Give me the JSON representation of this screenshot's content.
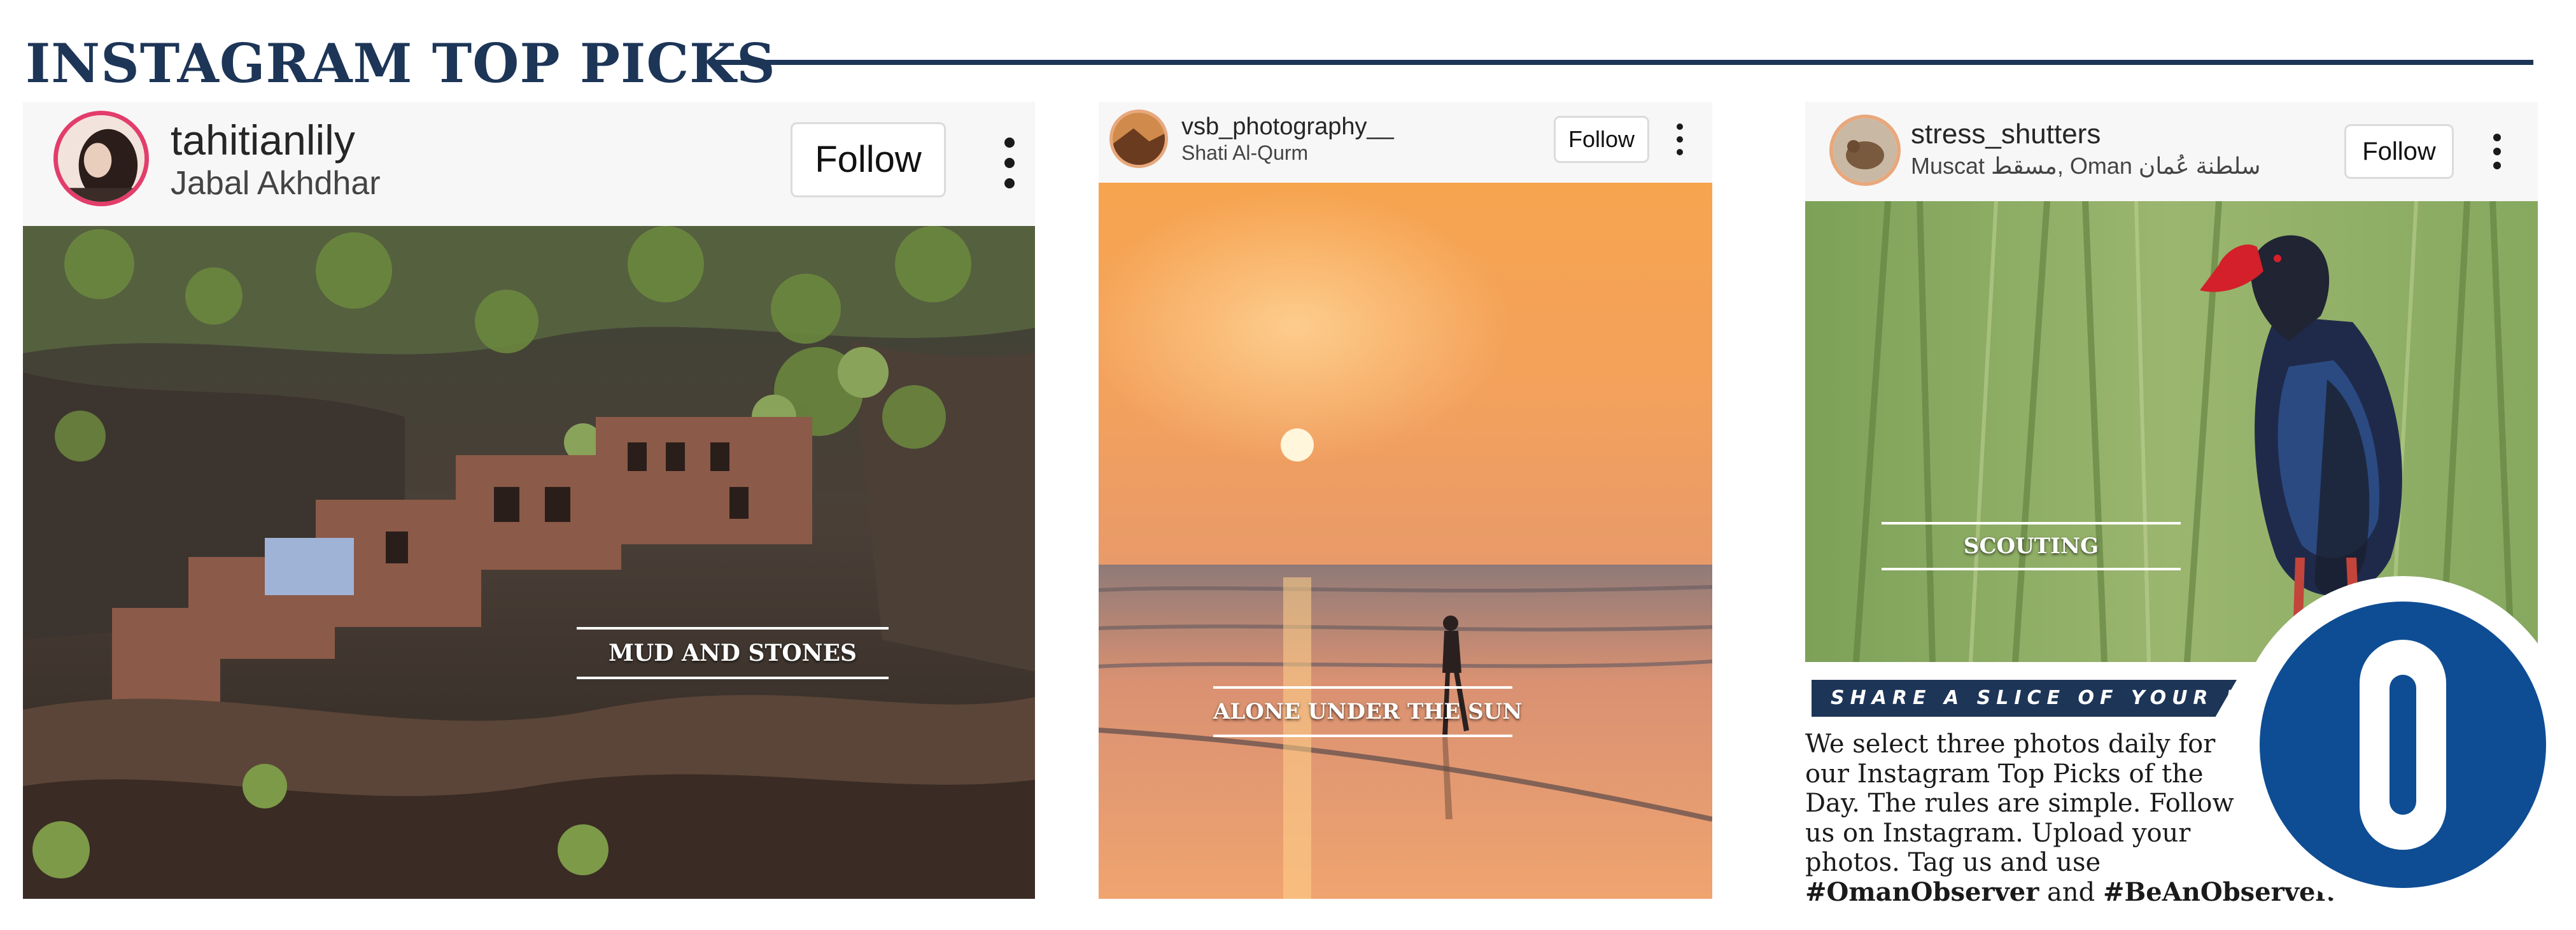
{
  "section": {
    "title": "INSTAGRAM TOP PICKS"
  },
  "colors": {
    "navy": "#1d3557",
    "logo_blue": "#0e4d94"
  },
  "posts": [
    {
      "username": "tahitianlily",
      "location": "Jabal Akhdhar",
      "follow_label": "Follow",
      "caption": "MUD AND STONES",
      "photo_subject": "ruined mud-brick village on a mountain cliffside"
    },
    {
      "username": "vsb_photography__",
      "location": "Shati Al-Qurm",
      "follow_label": "Follow",
      "caption": "ALONE UNDER THE SUN",
      "photo_subject": "silhouette of a child walking along the beach at sunset"
    },
    {
      "username": "stress_shutters",
      "location": "Muscat مسقط, Oman سلطنة عُمان",
      "follow_label": "Follow",
      "caption": "SCOUTING",
      "photo_subject": "purple swamphen standing in tall green reeds"
    }
  ],
  "share": {
    "banner": "SHARE A SLICE OF YOUR LIFE",
    "lines": [
      "We select three photos daily for",
      "our Instagram Top Picks of the",
      "Day. The rules are simple. Follow",
      "us on Instagram. Upload your",
      "photos. Tag us and use"
    ],
    "hashtag1": "#OmanObserver",
    "connector": " and ",
    "hashtag2": "#BeAnObserver",
    "end": "."
  },
  "logo": {
    "letter": "O"
  }
}
